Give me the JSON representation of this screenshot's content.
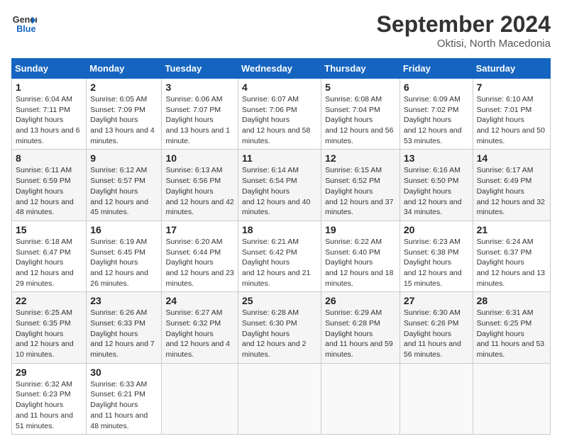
{
  "header": {
    "logo_line1": "General",
    "logo_line2": "Blue",
    "month_title": "September 2024",
    "subtitle": "Oktisi, North Macedonia"
  },
  "days_of_week": [
    "Sunday",
    "Monday",
    "Tuesday",
    "Wednesday",
    "Thursday",
    "Friday",
    "Saturday"
  ],
  "weeks": [
    [
      {
        "num": "1",
        "rise": "6:04 AM",
        "set": "7:11 PM",
        "daylight": "13 hours and 6 minutes."
      },
      {
        "num": "2",
        "rise": "6:05 AM",
        "set": "7:09 PM",
        "daylight": "13 hours and 4 minutes."
      },
      {
        "num": "3",
        "rise": "6:06 AM",
        "set": "7:07 PM",
        "daylight": "13 hours and 1 minute."
      },
      {
        "num": "4",
        "rise": "6:07 AM",
        "set": "7:06 PM",
        "daylight": "12 hours and 58 minutes."
      },
      {
        "num": "5",
        "rise": "6:08 AM",
        "set": "7:04 PM",
        "daylight": "12 hours and 56 minutes."
      },
      {
        "num": "6",
        "rise": "6:09 AM",
        "set": "7:02 PM",
        "daylight": "12 hours and 53 minutes."
      },
      {
        "num": "7",
        "rise": "6:10 AM",
        "set": "7:01 PM",
        "daylight": "12 hours and 50 minutes."
      }
    ],
    [
      {
        "num": "8",
        "rise": "6:11 AM",
        "set": "6:59 PM",
        "daylight": "12 hours and 48 minutes."
      },
      {
        "num": "9",
        "rise": "6:12 AM",
        "set": "6:57 PM",
        "daylight": "12 hours and 45 minutes."
      },
      {
        "num": "10",
        "rise": "6:13 AM",
        "set": "6:56 PM",
        "daylight": "12 hours and 42 minutes."
      },
      {
        "num": "11",
        "rise": "6:14 AM",
        "set": "6:54 PM",
        "daylight": "12 hours and 40 minutes."
      },
      {
        "num": "12",
        "rise": "6:15 AM",
        "set": "6:52 PM",
        "daylight": "12 hours and 37 minutes."
      },
      {
        "num": "13",
        "rise": "6:16 AM",
        "set": "6:50 PM",
        "daylight": "12 hours and 34 minutes."
      },
      {
        "num": "14",
        "rise": "6:17 AM",
        "set": "6:49 PM",
        "daylight": "12 hours and 32 minutes."
      }
    ],
    [
      {
        "num": "15",
        "rise": "6:18 AM",
        "set": "6:47 PM",
        "daylight": "12 hours and 29 minutes."
      },
      {
        "num": "16",
        "rise": "6:19 AM",
        "set": "6:45 PM",
        "daylight": "12 hours and 26 minutes."
      },
      {
        "num": "17",
        "rise": "6:20 AM",
        "set": "6:44 PM",
        "daylight": "12 hours and 23 minutes."
      },
      {
        "num": "18",
        "rise": "6:21 AM",
        "set": "6:42 PM",
        "daylight": "12 hours and 21 minutes."
      },
      {
        "num": "19",
        "rise": "6:22 AM",
        "set": "6:40 PM",
        "daylight": "12 hours and 18 minutes."
      },
      {
        "num": "20",
        "rise": "6:23 AM",
        "set": "6:38 PM",
        "daylight": "12 hours and 15 minutes."
      },
      {
        "num": "21",
        "rise": "6:24 AM",
        "set": "6:37 PM",
        "daylight": "12 hours and 13 minutes."
      }
    ],
    [
      {
        "num": "22",
        "rise": "6:25 AM",
        "set": "6:35 PM",
        "daylight": "12 hours and 10 minutes."
      },
      {
        "num": "23",
        "rise": "6:26 AM",
        "set": "6:33 PM",
        "daylight": "12 hours and 7 minutes."
      },
      {
        "num": "24",
        "rise": "6:27 AM",
        "set": "6:32 PM",
        "daylight": "12 hours and 4 minutes."
      },
      {
        "num": "25",
        "rise": "6:28 AM",
        "set": "6:30 PM",
        "daylight": "12 hours and 2 minutes."
      },
      {
        "num": "26",
        "rise": "6:29 AM",
        "set": "6:28 PM",
        "daylight": "11 hours and 59 minutes."
      },
      {
        "num": "27",
        "rise": "6:30 AM",
        "set": "6:26 PM",
        "daylight": "11 hours and 56 minutes."
      },
      {
        "num": "28",
        "rise": "6:31 AM",
        "set": "6:25 PM",
        "daylight": "11 hours and 53 minutes."
      }
    ],
    [
      {
        "num": "29",
        "rise": "6:32 AM",
        "set": "6:23 PM",
        "daylight": "11 hours and 51 minutes."
      },
      {
        "num": "30",
        "rise": "6:33 AM",
        "set": "6:21 PM",
        "daylight": "11 hours and 48 minutes."
      },
      null,
      null,
      null,
      null,
      null
    ]
  ]
}
